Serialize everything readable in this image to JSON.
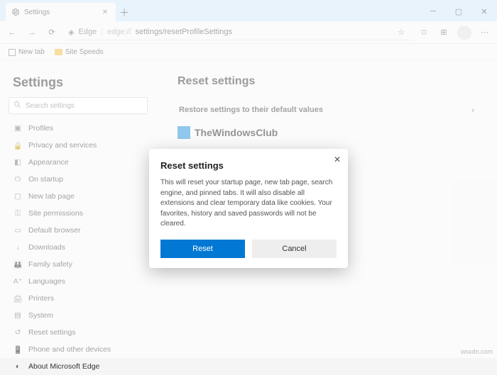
{
  "tab": {
    "title": "Settings"
  },
  "address": {
    "app": "Edge",
    "proto": "edge://",
    "path": "settings/resetProfileSettings"
  },
  "favorites": {
    "newtab": "New tab",
    "sitespeeds": "Site Speeds"
  },
  "sidebar": {
    "title": "Settings",
    "search_placeholder": "Search settings",
    "items": [
      {
        "label": "Profiles"
      },
      {
        "label": "Privacy and services"
      },
      {
        "label": "Appearance"
      },
      {
        "label": "On startup"
      },
      {
        "label": "New tab page"
      },
      {
        "label": "Site permissions"
      },
      {
        "label": "Default browser"
      },
      {
        "label": "Downloads"
      },
      {
        "label": "Family safety"
      },
      {
        "label": "Languages"
      },
      {
        "label": "Printers"
      },
      {
        "label": "System"
      },
      {
        "label": "Reset settings"
      },
      {
        "label": "Phone and other devices"
      },
      {
        "label": "About Microsoft Edge"
      }
    ]
  },
  "main": {
    "title": "Reset settings",
    "option": "Restore settings to their default values",
    "brand": "TheWindowsClub"
  },
  "dialog": {
    "title": "Reset settings",
    "body": "This will reset your startup page, new tab page, search engine, and pinned tabs. It will also disable all extensions and clear temporary data like cookies. Your favorites, history and saved passwords will not be cleared.",
    "primary": "Reset",
    "secondary": "Cancel"
  },
  "watermark": "wsxdn.com"
}
